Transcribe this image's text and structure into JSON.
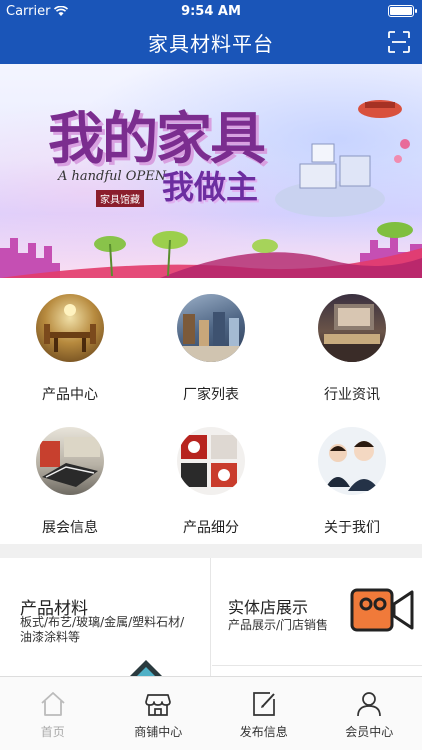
{
  "status_bar": {
    "carrier": "Carrier",
    "time": "9:54 AM"
  },
  "nav": {
    "title": "家具材料平台",
    "right_icon": "scan-icon"
  },
  "banner": {
    "title_main": "我的家具",
    "title_sub": "我做主",
    "english": "A handful OPEN",
    "tag": "家具馆藏"
  },
  "menu": [
    {
      "label": "产品中心",
      "icon": "product-center-photo"
    },
    {
      "label": "厂家列表",
      "icon": "factory-list-photo"
    },
    {
      "label": "行业资讯",
      "icon": "industry-news-photo"
    },
    {
      "label": "展会信息",
      "icon": "exhibition-photo"
    },
    {
      "label": "产品细分",
      "icon": "product-category-photo"
    },
    {
      "label": "关于我们",
      "icon": "about-us-photo"
    }
  ],
  "cards": {
    "left": {
      "title": "产品材料",
      "desc": "板式/布艺/玻璃/金属/塑料石材/油漆涂料等"
    },
    "right": {
      "title": "实体店展示",
      "desc": "产品展示/门店销售",
      "icon": "video-camera-icon"
    }
  },
  "tabs": [
    {
      "label": "首页",
      "icon": "home-icon",
      "active": false
    },
    {
      "label": "商铺中心",
      "icon": "store-icon",
      "active": true
    },
    {
      "label": "发布信息",
      "icon": "edit-icon",
      "active": true
    },
    {
      "label": "会员中心",
      "icon": "user-icon",
      "active": true
    }
  ],
  "colors": {
    "brand": "#1a55b8",
    "camera_orange": "#f07a3a"
  }
}
